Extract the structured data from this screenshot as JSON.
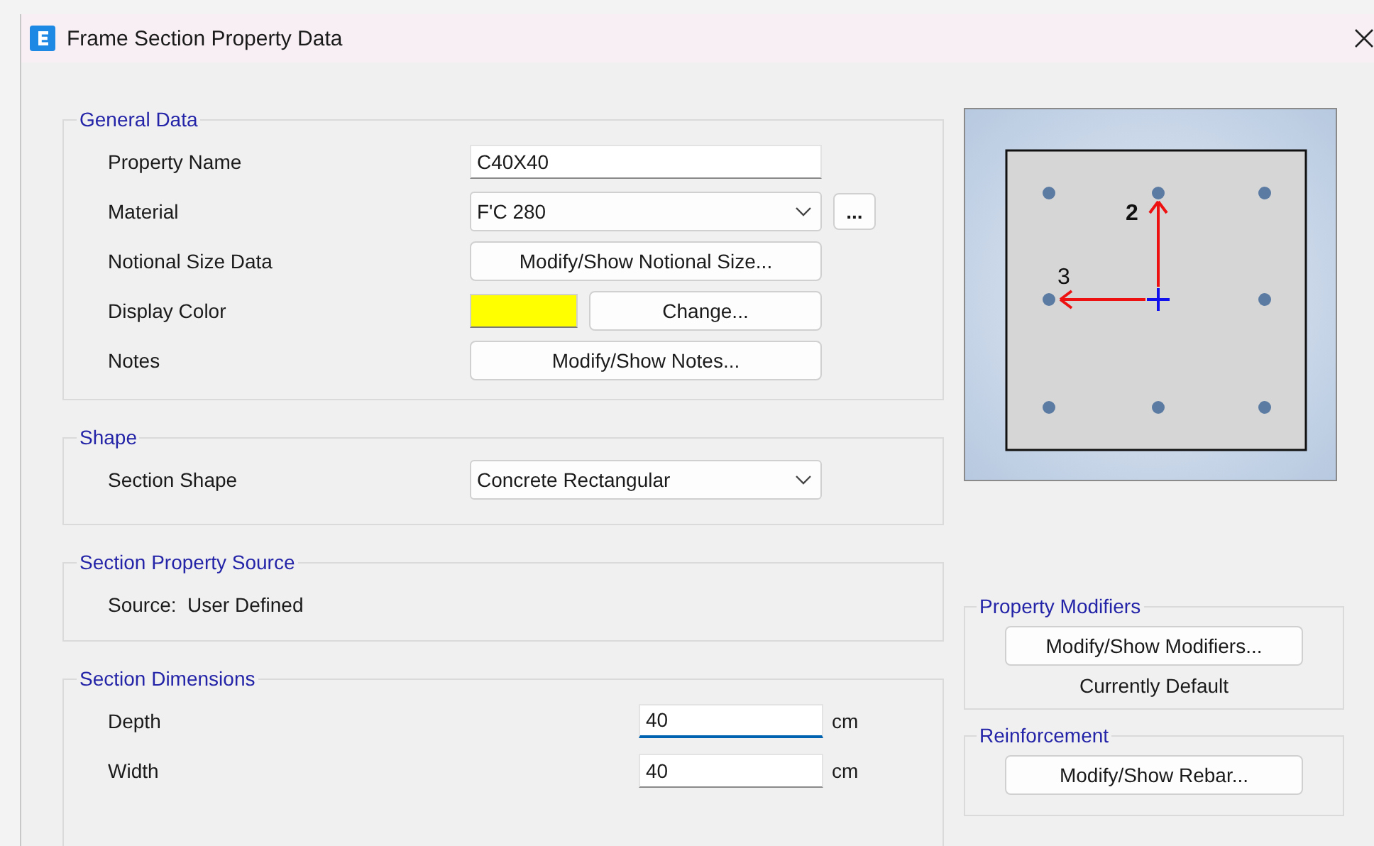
{
  "window": {
    "title": "Frame Section Property Data"
  },
  "general_data": {
    "title": "General Data",
    "rows": [
      {
        "kind": "text",
        "label": "Property Name",
        "value": "C40X40"
      },
      {
        "kind": "dropdown",
        "label": "Material",
        "value": "F'C 280",
        "extra_button": "..."
      },
      {
        "kind": "button",
        "label": "Notional Size Data",
        "button": "Modify/Show Notional Size..."
      },
      {
        "kind": "color",
        "label": "Display Color",
        "color": "#ffff00",
        "button": "Change..."
      },
      {
        "kind": "button",
        "label": "Notes",
        "button": "Modify/Show Notes..."
      }
    ]
  },
  "shape": {
    "title": "Shape",
    "label": "Section Shape",
    "value": "Concrete Rectangular"
  },
  "section_property_source": {
    "title": "Section Property Source",
    "text": "Source:  User Defined"
  },
  "section_dimensions": {
    "title": "Section Dimensions",
    "rows": [
      {
        "label": "Depth",
        "value": "40",
        "unit": "cm",
        "focused": true
      },
      {
        "label": "Width",
        "value": "40",
        "unit": "cm",
        "focused": false
      }
    ]
  },
  "section_preview": {
    "axis_labels": [
      "2",
      "3"
    ]
  },
  "property_modifiers": {
    "title": "Property Modifiers",
    "button": "Modify/Show Modifiers...",
    "status": "Currently Default"
  },
  "reinforcement": {
    "title": "Reinforcement",
    "button": "Modify/Show Rebar..."
  }
}
